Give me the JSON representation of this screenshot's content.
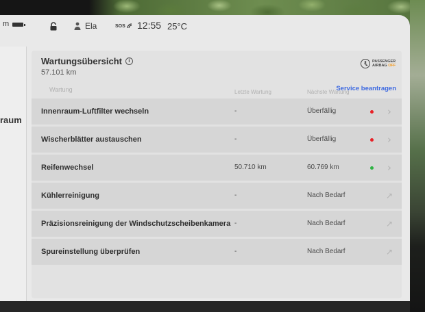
{
  "colors": {
    "accent": "#3e6ae1",
    "overdue": "#e82127",
    "ok": "#2fb344",
    "airbag_off": "#f39a1e"
  },
  "status_bar": {
    "left_partial": "m",
    "user_name": "Ela",
    "sos_label": "SOS",
    "time": "12:55",
    "temperature": "25°C",
    "icons": [
      "battery-icon",
      "lock-icon",
      "user-icon",
      "call-signal-icon"
    ]
  },
  "side_nav": {
    "partial_item_label": "raum"
  },
  "airbag_indicator": {
    "icon": "passenger-airbag-icon",
    "line1": "PASSENGER",
    "line2": "AIRBAG",
    "state": "OFF"
  },
  "maintenance": {
    "title": "Wartungsübersicht",
    "info_icon": "info-icon",
    "odometer": "57.101 km",
    "service_link": "Service beantragen",
    "columns": {
      "item": "Wartung",
      "last": "Letzte Wartung",
      "next": "Nächste Wartung"
    },
    "rows": [
      {
        "label": "Innenraum-Luftfilter wechseln",
        "last": "-",
        "next": "Überfällig",
        "dot_color": "#e82127",
        "action_icon": "chevron-right-icon"
      },
      {
        "label": "Wischerblätter austauschen",
        "last": "-",
        "next": "Überfällig",
        "dot_color": "#e82127",
        "action_icon": "chevron-right-icon"
      },
      {
        "label": "Reifenwechsel",
        "last": "50.710 km",
        "next": "60.769 km",
        "dot_color": "#2fb344",
        "action_icon": "chevron-right-icon"
      },
      {
        "label": "Kühlerreinigung",
        "last": "-",
        "next": "Nach Bedarf",
        "action_icon": "external-link-icon"
      },
      {
        "label": "Präzisionsreinigung der Windschutzscheibenkamera",
        "last": "-",
        "next": "Nach Bedarf",
        "action_icon": "external-link-icon"
      },
      {
        "label": "Spureinstellung überprüfen",
        "last": "-",
        "next": "Nach Bedarf",
        "action_icon": "external-link-icon"
      }
    ]
  }
}
